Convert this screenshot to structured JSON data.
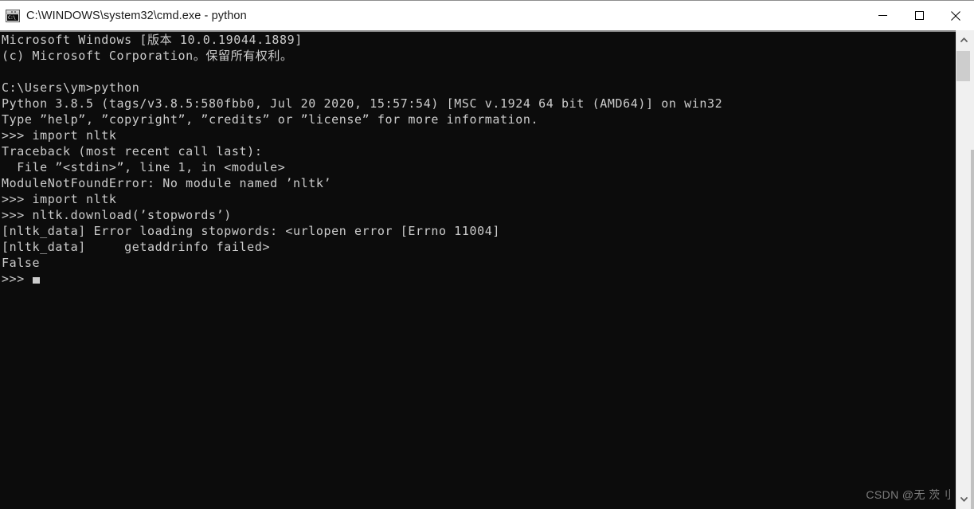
{
  "window": {
    "title": "C:\\WINDOWS\\system32\\cmd.exe - python",
    "icon": "cmd-console-icon",
    "icon_text": "C:\\",
    "titlebar_bg": "#ffffff",
    "console_bg": "#0c0c0c",
    "console_fg": "#cccccc"
  },
  "caption": {
    "minimize_label": "Minimize",
    "maximize_label": "Maximize",
    "close_label": "Close"
  },
  "terminal": {
    "lines": [
      "Microsoft Windows [版本 10.0.19044.1889]",
      "(c) Microsoft Corporation。保留所有权利。",
      "",
      "C:\\Users\\ym>python",
      "Python 3.8.5 (tags/v3.8.5:580fbb0, Jul 20 2020, 15:57:54) [MSC v.1924 64 bit (AMD64)] on win32",
      "Type ”help”, ”copyright”, ”credits” or ”license” for more information.",
      ">>> import nltk",
      "Traceback (most recent call last):",
      "  File ”<stdin>”, line 1, in <module>",
      "ModuleNotFoundError: No module named ’nltk’",
      ">>> import nltk",
      ">>> nltk.download(’stopwords’)",
      "[nltk_data] Error loading stopwords: <urlopen error [Errno 11004]",
      "[nltk_data]     getaddrinfo failed>",
      "False"
    ],
    "prompt": ">>> ",
    "cursor": "block-cursor"
  },
  "scrollbar": {
    "up_arrow": "chevron-up-icon",
    "down_arrow": "chevron-down-icon",
    "thumb_color": "#cdcdcd",
    "track_color": "#f0f0f0"
  },
  "watermark": {
    "text": "CSDN @无 茨刂"
  }
}
